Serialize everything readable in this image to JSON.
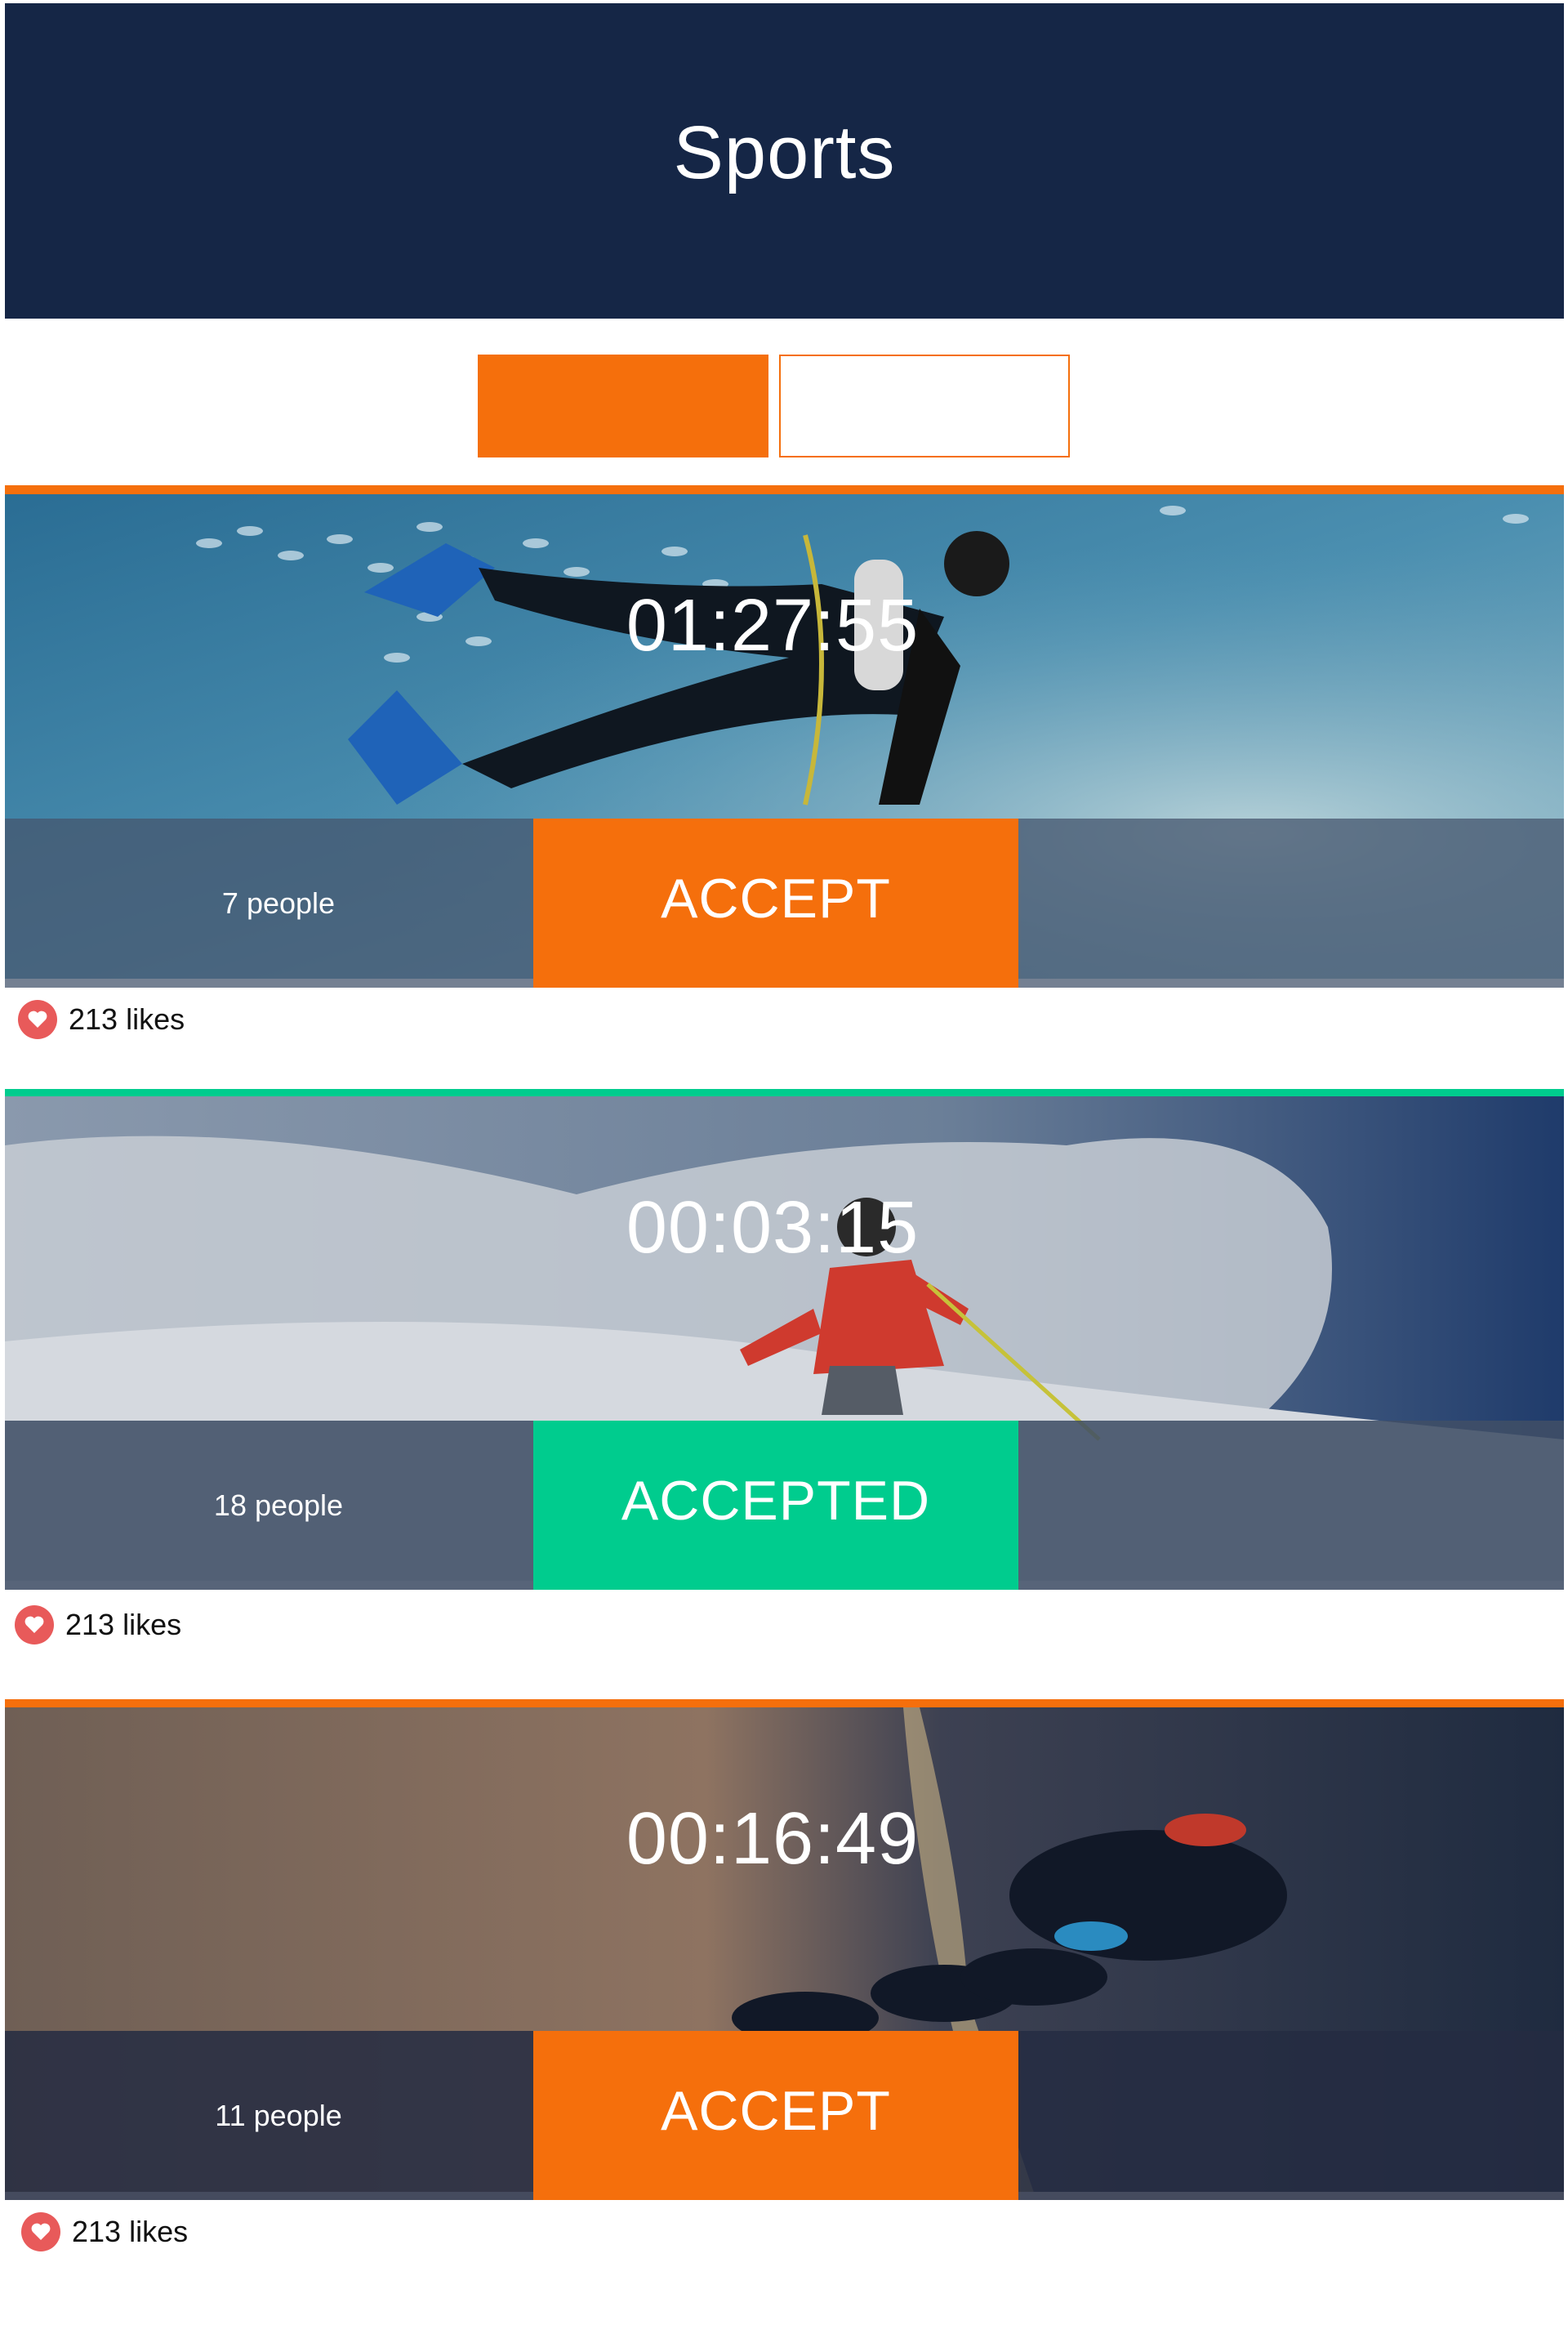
{
  "header": {
    "title": "Sports"
  },
  "colors": {
    "header_bg": "#152646",
    "accent_orange": "#f56f0c",
    "accent_green": "#00cc8e",
    "heart_red": "#e85a5a"
  },
  "tabs": [
    {
      "label": "",
      "state": "selected"
    },
    {
      "label": "",
      "state": "unselected"
    }
  ],
  "cards": [
    {
      "image": "scuba-diver-underwater-icon",
      "timer": "01:27:55",
      "people": "7 people",
      "action": "ACCEPT",
      "status": "pending",
      "accent": "#f56f0c",
      "likes": "213 likes"
    },
    {
      "image": "skier-powder-snow-icon",
      "timer": "00:03:15",
      "people": "18 people",
      "action": "ACCEPTED",
      "status": "accepted",
      "accent": "#00cc8e",
      "likes": "213 likes"
    },
    {
      "image": "skydivers-formation-icon",
      "timer": "00:16:49",
      "people": "11 people",
      "action": "ACCEPT",
      "status": "pending",
      "accent": "#f56f0c",
      "likes": "213 likes"
    }
  ]
}
